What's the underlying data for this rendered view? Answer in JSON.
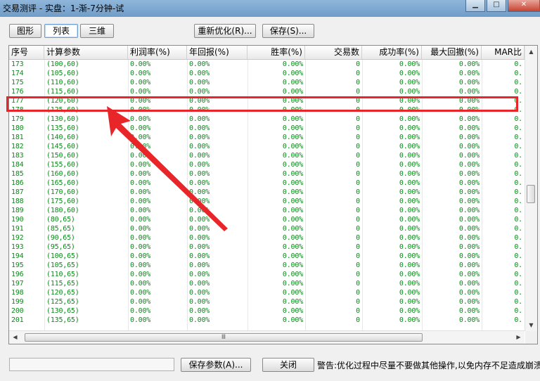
{
  "window": {
    "title": "交易测评 - 实盘：1-渐-7分钟-试",
    "controls": [
      "minimize",
      "maximize",
      "close"
    ]
  },
  "toolbar": {
    "graph_tab": "图形",
    "list_tab": "列表",
    "threed_tab": "三维",
    "reoptimize": "重新优化(R)...",
    "save": "保存(S)..."
  },
  "table": {
    "columns": [
      "序号",
      "计算参数",
      "利润率(%)",
      "年回报(%)",
      "胜率(%)",
      "交易数",
      "成功率(%)",
      "最大回撤(%)",
      "MAR比"
    ],
    "rows": [
      [
        "173",
        "(100,60)",
        "0.00%",
        "0.00%",
        "0.00%",
        "0",
        "0.00%",
        "0.00%",
        "0."
      ],
      [
        "174",
        "(105,60)",
        "0.00%",
        "0.00%",
        "0.00%",
        "0",
        "0.00%",
        "0.00%",
        "0."
      ],
      [
        "175",
        "(110,60)",
        "0.00%",
        "0.00%",
        "0.00%",
        "0",
        "0.00%",
        "0.00%",
        "0."
      ],
      [
        "176",
        "(115,60)",
        "0.00%",
        "0.00%",
        "0.00%",
        "0",
        "0.00%",
        "0.00%",
        "0."
      ],
      [
        "177",
        "(120,60)",
        "0.00%",
        "0.00%",
        "0.00%",
        "0",
        "0.00%",
        "0.00%",
        "0."
      ],
      [
        "178",
        "(125,60)",
        "0.00%",
        "0.00%",
        "0.00%",
        "0",
        "0.00%",
        "0.00%",
        "0."
      ],
      [
        "179",
        "(130,60)",
        "0.00%",
        "0.00%",
        "0.00%",
        "0",
        "0.00%",
        "0.00%",
        "0."
      ],
      [
        "180",
        "(135,60)",
        "0.00%",
        "0.00%",
        "0.00%",
        "0",
        "0.00%",
        "0.00%",
        "0."
      ],
      [
        "181",
        "(140,60)",
        "0.00%",
        "0.00%",
        "0.00%",
        "0",
        "0.00%",
        "0.00%",
        "0."
      ],
      [
        "182",
        "(145,60)",
        "0.00%",
        "0.00%",
        "0.00%",
        "0",
        "0.00%",
        "0.00%",
        "0."
      ],
      [
        "183",
        "(150,60)",
        "0.00%",
        "0.00%",
        "0.00%",
        "0",
        "0.00%",
        "0.00%",
        "0."
      ],
      [
        "184",
        "(155,60)",
        "0.00%",
        "0.00%",
        "0.00%",
        "0",
        "0.00%",
        "0.00%",
        "0."
      ],
      [
        "185",
        "(160,60)",
        "0.00%",
        "0.00%",
        "0.00%",
        "0",
        "0.00%",
        "0.00%",
        "0."
      ],
      [
        "186",
        "(165,60)",
        "0.00%",
        "0.00%",
        "0.00%",
        "0",
        "0.00%",
        "0.00%",
        "0."
      ],
      [
        "187",
        "(170,60)",
        "0.00%",
        "0.00%",
        "0.00%",
        "0",
        "0.00%",
        "0.00%",
        "0."
      ],
      [
        "188",
        "(175,60)",
        "0.00%",
        "0.00%",
        "0.00%",
        "0",
        "0.00%",
        "0.00%",
        "0."
      ],
      [
        "189",
        "(180,60)",
        "0.00%",
        "0.00%",
        "0.00%",
        "0",
        "0.00%",
        "0.00%",
        "0."
      ],
      [
        "190",
        "(80,65)",
        "0.00%",
        "0.00%",
        "0.00%",
        "0",
        "0.00%",
        "0.00%",
        "0."
      ],
      [
        "191",
        "(85,65)",
        "0.00%",
        "0.00%",
        "0.00%",
        "0",
        "0.00%",
        "0.00%",
        "0."
      ],
      [
        "192",
        "(90,65)",
        "0.00%",
        "0.00%",
        "0.00%",
        "0",
        "0.00%",
        "0.00%",
        "0."
      ],
      [
        "193",
        "(95,65)",
        "0.00%",
        "0.00%",
        "0.00%",
        "0",
        "0.00%",
        "0.00%",
        "0."
      ],
      [
        "194",
        "(100,65)",
        "0.00%",
        "0.00%",
        "0.00%",
        "0",
        "0.00%",
        "0.00%",
        "0."
      ],
      [
        "195",
        "(105,65)",
        "0.00%",
        "0.00%",
        "0.00%",
        "0",
        "0.00%",
        "0.00%",
        "0."
      ],
      [
        "196",
        "(110,65)",
        "0.00%",
        "0.00%",
        "0.00%",
        "0",
        "0.00%",
        "0.00%",
        "0."
      ],
      [
        "197",
        "(115,65)",
        "0.00%",
        "0.00%",
        "0.00%",
        "0",
        "0.00%",
        "0.00%",
        "0."
      ],
      [
        "198",
        "(120,65)",
        "0.00%",
        "0.00%",
        "0.00%",
        "0",
        "0.00%",
        "0.00%",
        "0."
      ],
      [
        "199",
        "(125,65)",
        "0.00%",
        "0.00%",
        "0.00%",
        "0",
        "0.00%",
        "0.00%",
        "0."
      ],
      [
        "200",
        "(130,65)",
        "0.00%",
        "0.00%",
        "0.00%",
        "0",
        "0.00%",
        "0.00%",
        "0."
      ],
      [
        "201",
        "(135,65)",
        "0.00%",
        "0.00%",
        "0.00%",
        "0",
        "0.00%",
        "0.00%",
        "0."
      ]
    ],
    "row_color": "#0a8a1a",
    "highlighted_row": "177"
  },
  "scrollbar": {
    "h_thumb_glyph": "Ⅲ",
    "up_arrow": "▲",
    "down_arrow": "▼",
    "left_arrow": "◀",
    "right_arrow": "▶"
  },
  "bottom": {
    "save_params": "保存参数(A)...",
    "close": "关闭",
    "warning": "警告:优化过程中尽量不要做其他操作,以免内存不足造成崩溃"
  },
  "annotation": {
    "color": "#e8262a"
  }
}
